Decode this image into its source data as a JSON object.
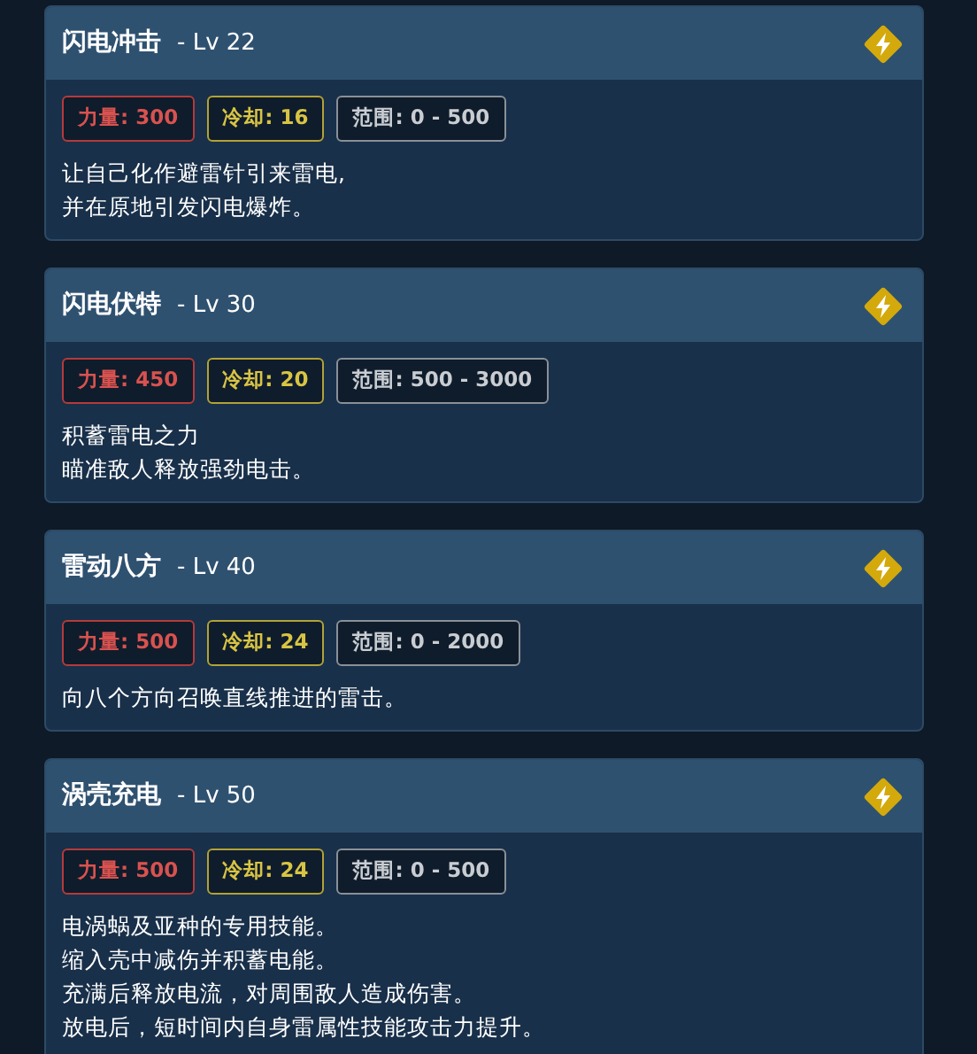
{
  "skills": [
    {
      "name": "闪电冲击",
      "level": "- Lv 22",
      "stats": [
        {
          "kind": "power",
          "text": "力量: 300"
        },
        {
          "kind": "cooldown",
          "text": "冷却: 16"
        },
        {
          "kind": "range",
          "text": "范围: 0 - 500"
        }
      ],
      "description": [
        "让自己化作避雷针引来雷电,",
        "并在原地引发闪电爆炸。"
      ]
    },
    {
      "name": "闪电伏特",
      "level": "- Lv 30",
      "stats": [
        {
          "kind": "power",
          "text": "力量: 450"
        },
        {
          "kind": "cooldown",
          "text": "冷却: 20"
        },
        {
          "kind": "range",
          "text": "范围: 500 - 3000"
        }
      ],
      "description": [
        "积蓄雷电之力",
        "瞄准敌人释放强劲电击。"
      ]
    },
    {
      "name": "雷动八方",
      "level": "- Lv 40",
      "stats": [
        {
          "kind": "power",
          "text": "力量: 500"
        },
        {
          "kind": "cooldown",
          "text": "冷却: 24"
        },
        {
          "kind": "range",
          "text": "范围: 0 - 2000"
        }
      ],
      "description": [
        "向八个方向召唤直线推进的雷击。"
      ]
    },
    {
      "name": "涡壳充电",
      "level": "- Lv 50",
      "stats": [
        {
          "kind": "power",
          "text": "力量: 500"
        },
        {
          "kind": "cooldown",
          "text": "冷却: 24"
        },
        {
          "kind": "range",
          "text": "范围: 0 - 500"
        }
      ],
      "description": [
        "电涡蜗及亚种的专用技能。",
        "缩入壳中减伤并积蓄电能。",
        "充满后释放电流，对周围敌人造成伤害。",
        "放电后，短时间内自身雷属性技能攻击力提升。"
      ]
    }
  ]
}
